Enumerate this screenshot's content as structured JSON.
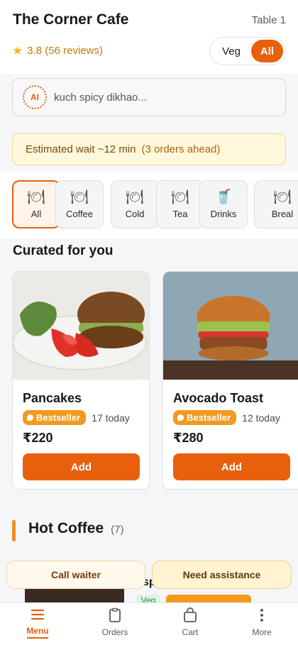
{
  "header": {
    "cafe_name": "The Corner Cafe",
    "table": "Table 1",
    "rating": "3.8 (56 reviews)",
    "filter_veg": "Veg",
    "filter_all": "All",
    "active_filter": "All"
  },
  "ai_search": {
    "badge": "AI",
    "placeholder": "kuch spicy dikhao..."
  },
  "wait": {
    "text": "Estimated wait ~12 min",
    "ahead": "(3 orders ahead)"
  },
  "categories": [
    {
      "label": "All",
      "icon": "plate-icon",
      "active": true
    },
    {
      "label": "Coffee",
      "icon": "plate-icon"
    },
    {
      "label": "Cold",
      "icon": "plate-icon"
    },
    {
      "label": "Tea",
      "icon": "plate-icon"
    },
    {
      "label": "Drinks",
      "icon": "cup-icon"
    },
    {
      "label": "Breal",
      "icon": "plate-icon"
    }
  ],
  "curated": {
    "title": "Curated for you",
    "items": [
      {
        "name": "Pancakes",
        "badge": "Bestseller",
        "count": "17 today",
        "price": "₹220",
        "add_label": "Add"
      },
      {
        "name": "Avocado Toast",
        "badge": "Bestseller",
        "count": "12 today",
        "price": "₹280",
        "add_label": "Add"
      }
    ]
  },
  "hot_coffee": {
    "title": "Hot Coffee",
    "count": "(7)",
    "partial_name": "sp",
    "partial_veg": "Veg"
  },
  "actions": {
    "call_waiter": "Call waiter",
    "need_assistance": "Need assistance"
  },
  "tabs": [
    {
      "label": "Menu",
      "icon": "menu-icon",
      "active": true
    },
    {
      "label": "Orders",
      "icon": "clipboard-icon"
    },
    {
      "label": "Cart",
      "icon": "bag-icon"
    },
    {
      "label": "More",
      "icon": "more-icon"
    }
  ],
  "colors": {
    "accent": "#e8600c",
    "bestseller": "#f39a1f",
    "wait_bg": "#fff8dc"
  }
}
